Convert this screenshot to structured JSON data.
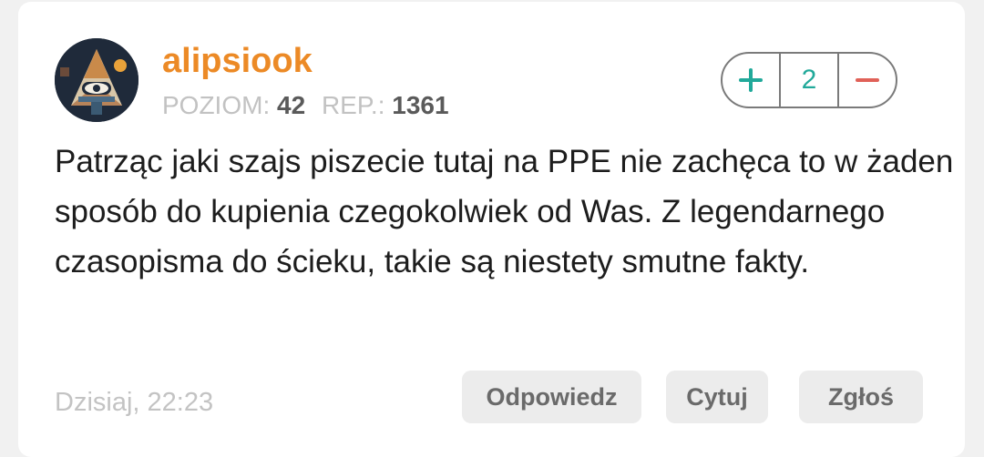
{
  "comment": {
    "author": {
      "username": "alipsiook",
      "level_label": "POZIOM:",
      "level_value": "42",
      "rep_label": "REP.:",
      "rep_value": "1361",
      "avatar_icon": "illuminati-eye-pyramid-avatar"
    },
    "vote": {
      "plus_icon": "plus-icon",
      "score": "2",
      "minus_icon": "minus-icon"
    },
    "text": "Patrząc jaki szajs piszecie tutaj na PPE nie zachęca to w żaden sposób do kupienia czegokolwiek od Was. Z legendarnego czasopisma do ścieku, takie są niestety smutne fakty.",
    "timestamp": "Dzisiaj, 22:23",
    "actions": {
      "reply": "Odpowiedz",
      "quote": "Cytuj",
      "report": "Zgłoś"
    }
  },
  "colors": {
    "username": "#ec8a26",
    "upvote": "#21a99a",
    "downvote": "#e06158",
    "button_bg": "#ececec",
    "muted_text": "#c2c2c2"
  }
}
